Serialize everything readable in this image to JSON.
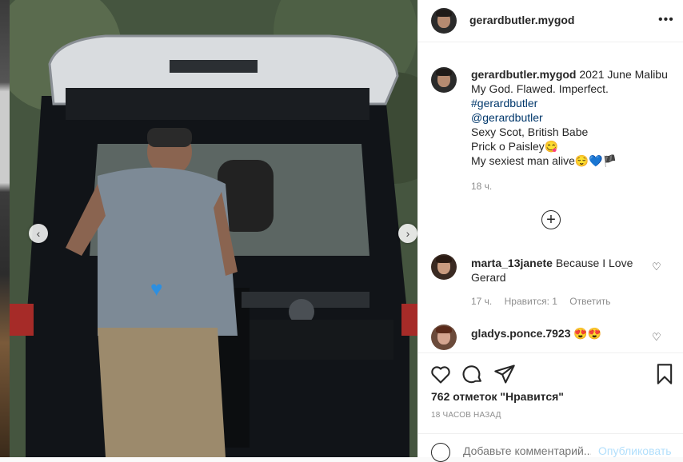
{
  "post": {
    "author": "gerardbutler.mygod",
    "caption": {
      "username": "gerardbutler.mygod",
      "line1_rest": "2021 June Malibu",
      "line2": "My God. Flawed. Imperfect.",
      "hashtag": "#gerardbutler",
      "mention": "@gerardbutler",
      "line5": "Sexy Scot, British Babe",
      "line6": "Prick o Paisley😋",
      "line7": "My sexiest man alive😌💙🏴"
    },
    "caption_time": "18 ч."
  },
  "comments": [
    {
      "username": "marta_13janete",
      "text_part1": "Because I Love",
      "text_part2": "Gerard",
      "time": "17 ч.",
      "likes": "Нравится: 1",
      "reply": "Ответить"
    },
    {
      "username": "gladys.ponce.7923",
      "text": "😍😍"
    }
  ],
  "footer": {
    "likes_text": "762 отметок \"Нравится\"",
    "time_ago": "18 ЧАСОВ НАЗАД",
    "comment_placeholder": "Добавьте комментарий...",
    "publish_label": "Опубликовать"
  },
  "icons": {
    "more": "more-options-icon",
    "heart": "heart-icon",
    "comment": "comment-icon",
    "share": "share-icon",
    "save": "bookmark-icon",
    "add": "plus-circle-icon",
    "emoji": "emoji-icon"
  },
  "colors": {
    "link": "#00376b",
    "publish": "#b2dffc",
    "muted": "#8e8e8e"
  }
}
